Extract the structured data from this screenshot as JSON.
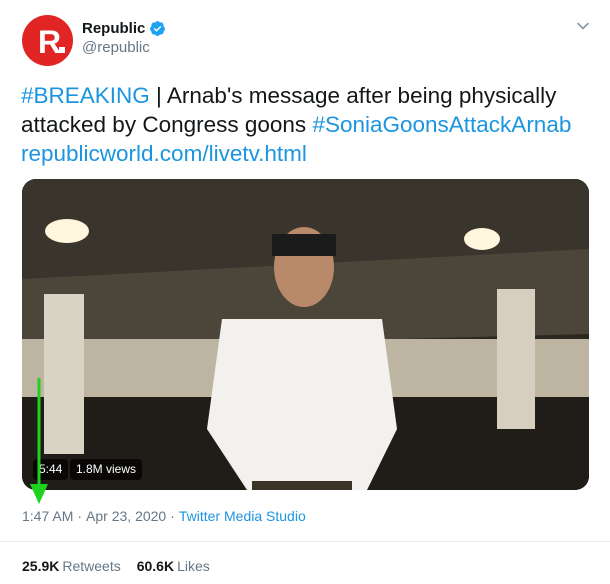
{
  "author": {
    "display_name": "Republic",
    "handle": "@republic",
    "avatar_letter": "R",
    "avatar_color": "#e12524",
    "verified_icon": "verified-badge-icon"
  },
  "tweet": {
    "hashtag_breaking": "#BREAKING",
    "text_main": " | Arnab's message after being physically attacked by Congress goons ",
    "hashtag_2": "#SoniaGoonsAttackArnab",
    "link": "republicworld.com/livetv.html"
  },
  "video": {
    "duration": "5:44",
    "views": "1.8M views"
  },
  "meta": {
    "time": "1:47 AM",
    "separator": "·",
    "date": "Apr 23, 2020",
    "source": "Twitter Media Studio"
  },
  "stats": {
    "retweets_count": "25.9K",
    "retweets_label": "Retweets",
    "likes_count": "60.6K",
    "likes_label": "Likes"
  },
  "colors": {
    "link": "#1b95e0",
    "secondary_text": "#657786",
    "annotation_arrow": "#1fd21f"
  }
}
